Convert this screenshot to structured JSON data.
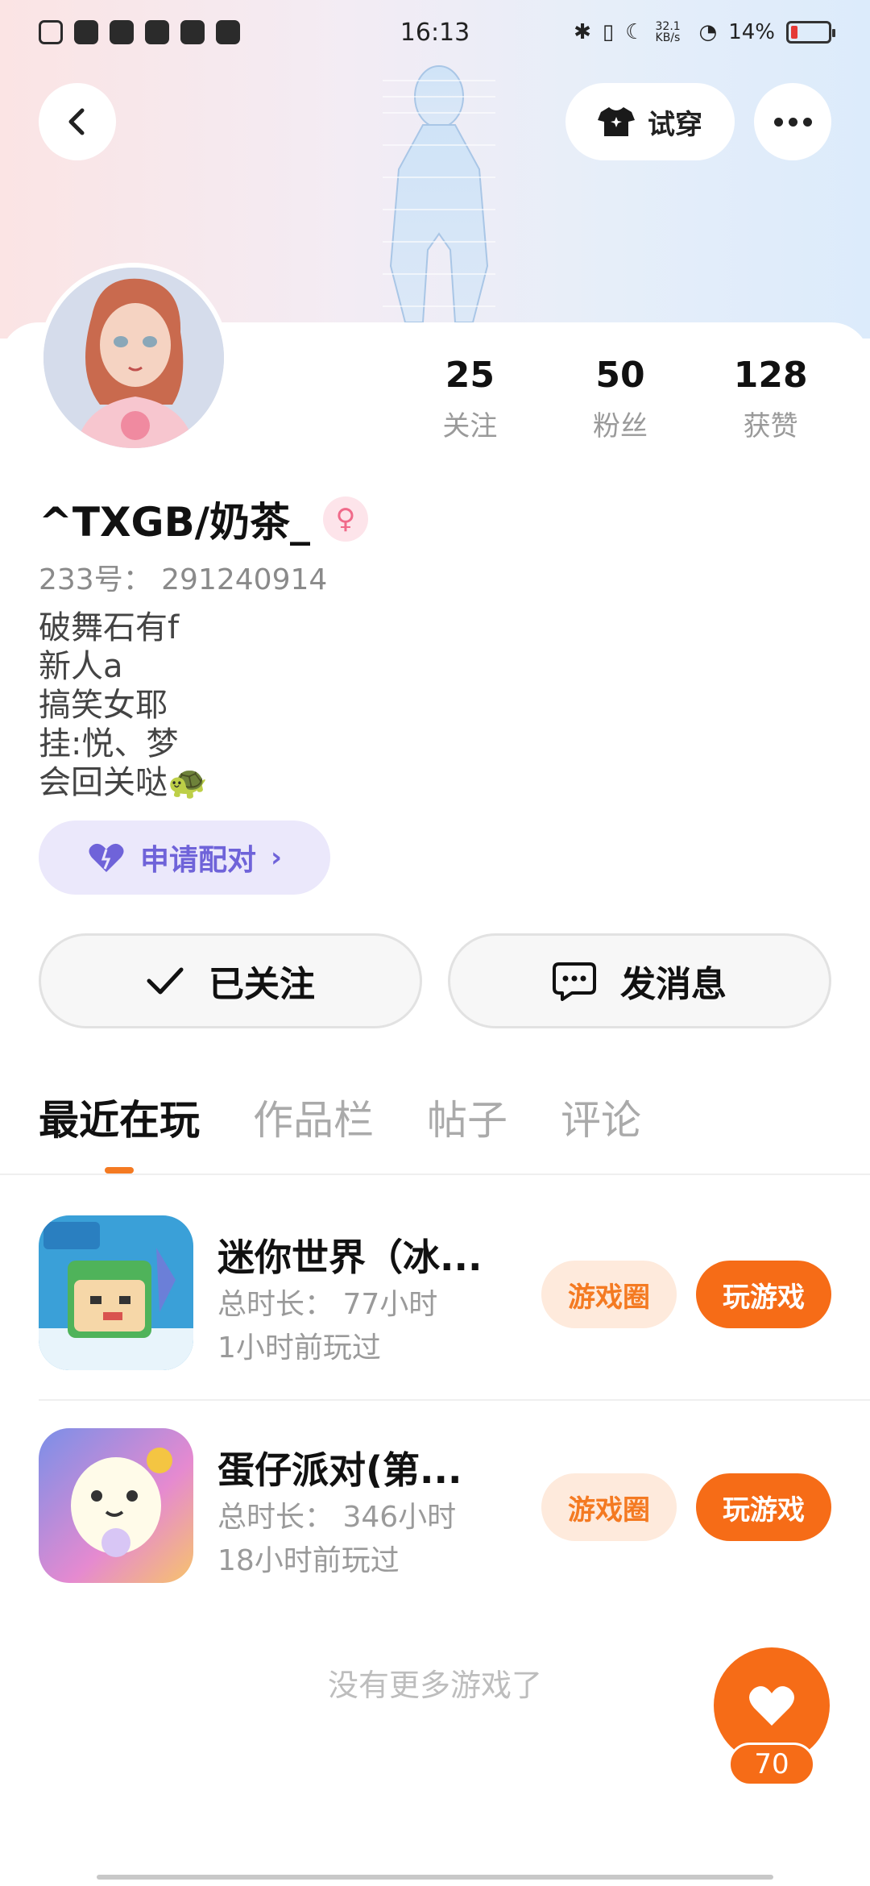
{
  "status_bar": {
    "time": "16:13",
    "net_speed": "32.1 KB/s",
    "battery": "14%"
  },
  "header": {
    "back_icon": "chevron-left-icon",
    "tryon_label": "试穿",
    "tryon_icon": "tshirt-icon",
    "more_icon": "ellipsis-icon"
  },
  "profile": {
    "username": "^TXGB/奶茶_",
    "gender_icon": "female-icon",
    "uid": "233号： 291240914",
    "bio": [
      "破舞石有f",
      "新人a",
      "搞笑女耶",
      "挂:悦、梦",
      "会回关哒🐢"
    ],
    "stats": [
      {
        "value": "25",
        "label": "关注"
      },
      {
        "value": "50",
        "label": "粉丝"
      },
      {
        "value": "128",
        "label": "获赞"
      }
    ]
  },
  "actions": {
    "pair_label": "申请配对",
    "followed_label": "已关注",
    "message_label": "发消息"
  },
  "tabs": [
    "最近在玩",
    "作品栏",
    "帖子",
    "评论"
  ],
  "games": [
    {
      "title": "迷你世界（冰...",
      "duration": "总时长： 77小时",
      "last_played": "1小时前玩过",
      "circle_label": "游戏圈",
      "play_label": "玩游戏"
    },
    {
      "title": "蛋仔派对(第...",
      "duration": "总时长： 346小时",
      "last_played": "18小时前玩过",
      "circle_label": "游戏圈",
      "play_label": "玩游戏"
    }
  ],
  "no_more_text": "没有更多游戏了",
  "like_count": "70",
  "colors": {
    "accent": "#f66c17",
    "pair_purple": "#6f63d9",
    "female_pink": "#f06a8a"
  }
}
